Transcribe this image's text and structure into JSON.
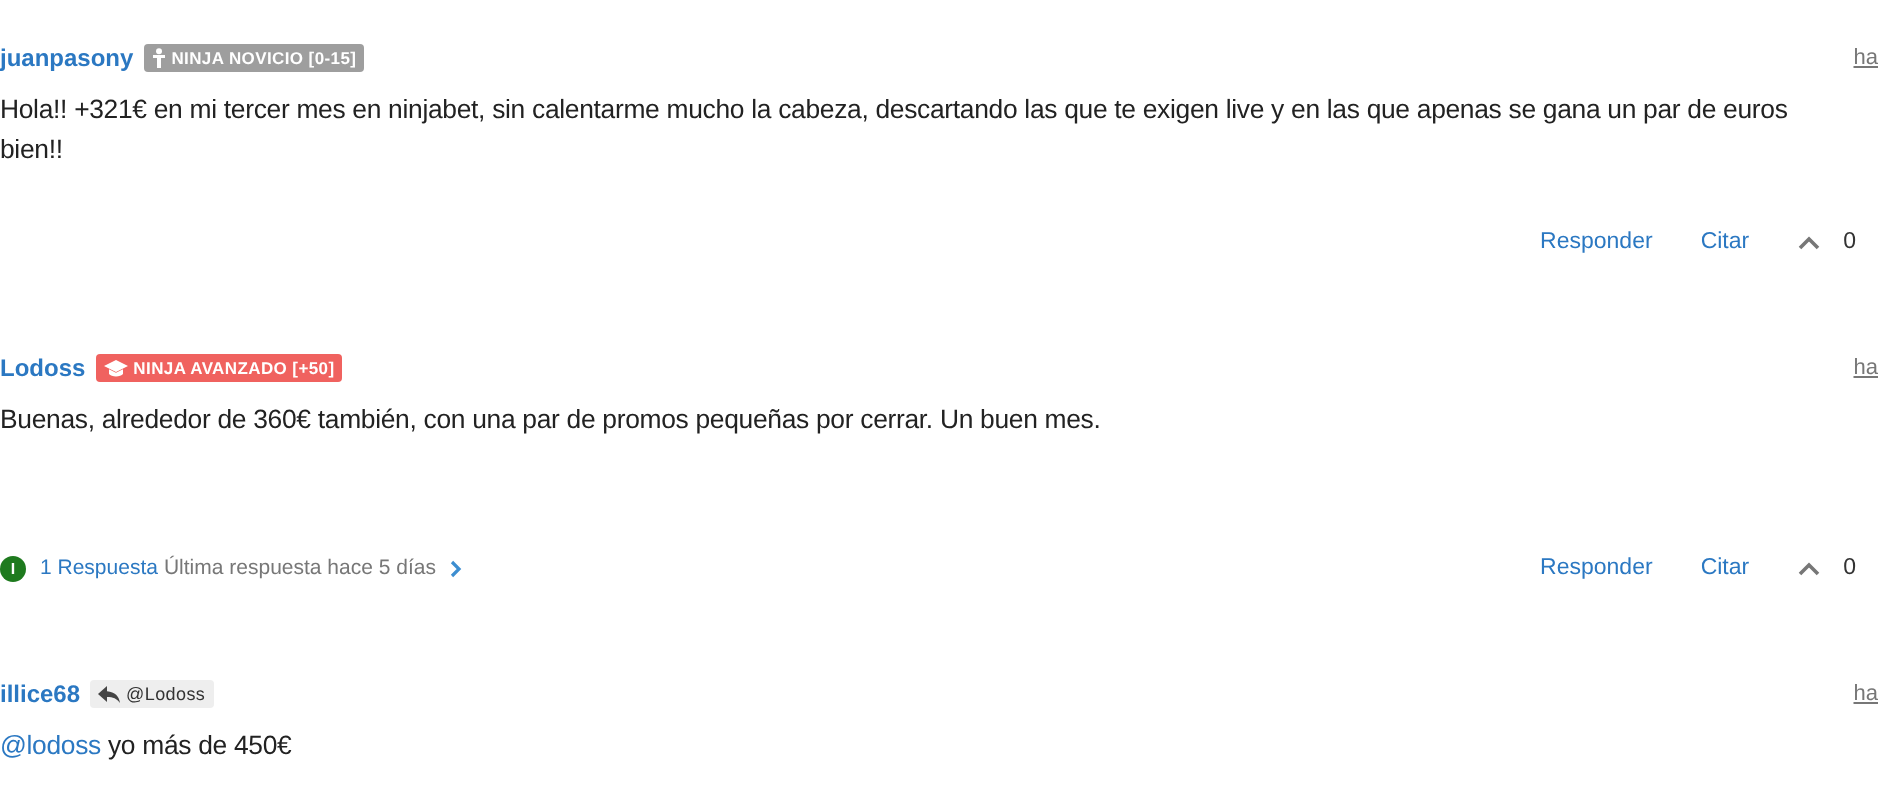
{
  "posts": [
    {
      "author": "juanpasony",
      "badge": {
        "kind": "novice",
        "text": "NINJA NOVICIO [0-15]"
      },
      "time": "ha",
      "body_lines": [
        [
          {
            "kind": "text",
            "text": "Hola!! +321€ en mi tercer mes en ninjabet, sin calentarme mucho la cabeza, descartando las que te exigen live y en las que apenas se gana un par de euros"
          }
        ],
        [
          {
            "kind": "text",
            "text": "bien!!"
          }
        ]
      ],
      "actions": {
        "reply": "Responder",
        "quote": "Citar",
        "votes": "0"
      }
    },
    {
      "author": "Lodoss",
      "badge": {
        "kind": "advanced",
        "text": "NINJA AVANZADO [+50]"
      },
      "time": "ha",
      "body_lines": [
        [
          {
            "kind": "text",
            "text": "Buenas, alrededor de 360€ también, con una par de promos pequeñas por cerrar. Un buen mes."
          }
        ]
      ],
      "replies": {
        "avatar_letter": "I",
        "count": "1 Respuesta",
        "last": "Última respuesta hace 5 días"
      },
      "actions": {
        "reply": "Responder",
        "quote": "Citar",
        "votes": "0"
      }
    },
    {
      "author": "illice68",
      "badge": {
        "kind": "reply_to",
        "text": "@Lodoss"
      },
      "time": "ha",
      "body_lines": [
        [
          {
            "kind": "mention",
            "text": "@lodoss"
          },
          {
            "kind": "text",
            "text": " yo más de 450€"
          }
        ]
      ]
    }
  ]
}
